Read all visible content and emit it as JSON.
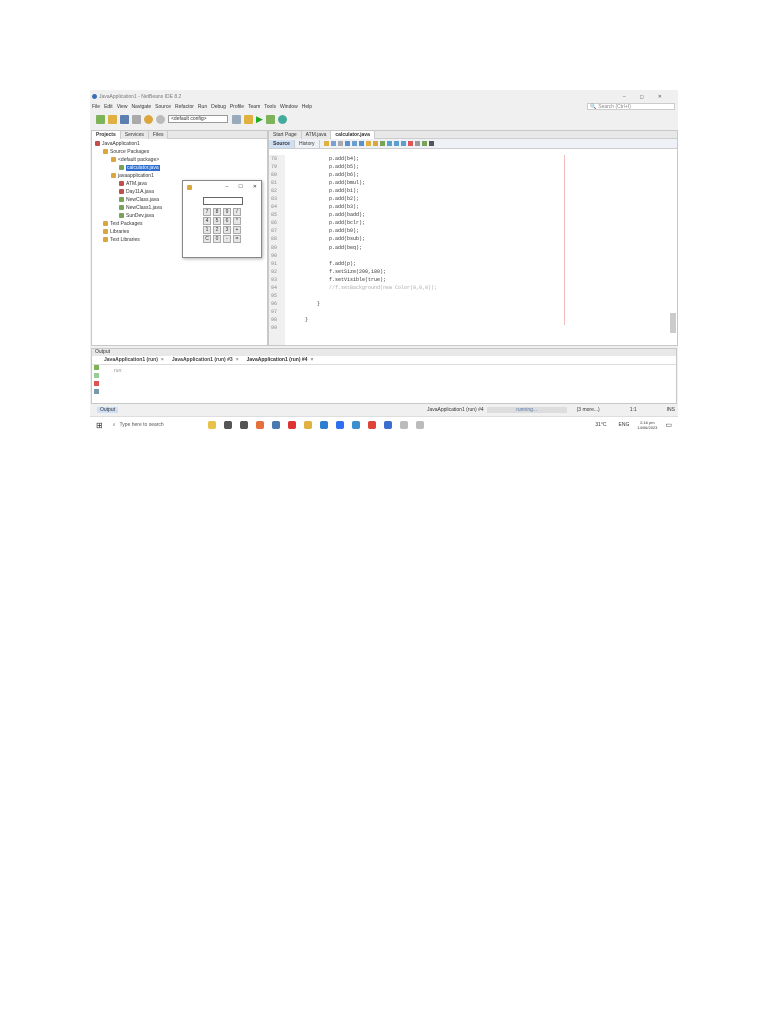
{
  "window": {
    "title": "JavaApplication1 - NetBeans IDE 8.2",
    "search_placeholder": "Search (Ctrl+I)"
  },
  "menu": [
    "File",
    "Edit",
    "View",
    "Navigate",
    "Source",
    "Refactor",
    "Run",
    "Debug",
    "Profile",
    "Team",
    "Tools",
    "Window",
    "Help"
  ],
  "toolbar": {
    "config": "<default config>"
  },
  "left_tabs": [
    "Projects",
    "Services",
    "Files"
  ],
  "tree": [
    {
      "label": "JavaApplication1",
      "level": 0,
      "color": "#c0504d"
    },
    {
      "label": "Source Packages",
      "level": 1,
      "color": "#d9a640"
    },
    {
      "label": "<default package>",
      "level": 2,
      "color": "#d9a640"
    },
    {
      "label": "calculator.java",
      "level": 3,
      "color": "#7aa35a",
      "selected": true
    },
    {
      "label": "javaapplication1",
      "level": 2,
      "color": "#d9a640"
    },
    {
      "label": "ATM.java",
      "level": 3,
      "color": "#c0504d"
    },
    {
      "label": "Day11A.java",
      "level": 3,
      "color": "#c0504d"
    },
    {
      "label": "NewClass.java",
      "level": 3,
      "color": "#7aa35a"
    },
    {
      "label": "NewClass1.java",
      "level": 3,
      "color": "#7aa35a"
    },
    {
      "label": "SunDev.java",
      "level": 3,
      "color": "#7aa35a"
    },
    {
      "label": "Test Packages",
      "level": 1,
      "color": "#d9a640"
    },
    {
      "label": "Libraries",
      "level": 1,
      "color": "#d9a640"
    },
    {
      "label": "Test Libraries",
      "level": 1,
      "color": "#d9a640"
    }
  ],
  "calculator": {
    "keys": [
      "7",
      "8",
      "9",
      "/",
      "4",
      "5",
      "6",
      "*",
      "1",
      "2",
      "3",
      "+",
      "C",
      "0",
      "-",
      "="
    ],
    "minimize": "–",
    "maximize": "☐",
    "close": "✕"
  },
  "editor_tabs": [
    "Start Page",
    "ATM.java",
    "calculator.java"
  ],
  "editor_subtabs": [
    "Source",
    "History"
  ],
  "code": [
    {
      "n": "78",
      "t": "        p.add(b4);"
    },
    {
      "n": "79",
      "t": "        p.add(b5);"
    },
    {
      "n": "80",
      "t": "        p.add(b6);"
    },
    {
      "n": "81",
      "t": "        p.add(bmul);"
    },
    {
      "n": "82",
      "t": "        p.add(b1);"
    },
    {
      "n": "83",
      "t": "        p.add(b2);"
    },
    {
      "n": "84",
      "t": "        p.add(b3);"
    },
    {
      "n": "85",
      "t": "        p.add(badd);"
    },
    {
      "n": "86",
      "t": "        p.add(bclr);"
    },
    {
      "n": "87",
      "t": "        p.add(b0);"
    },
    {
      "n": "88",
      "t": "        p.add(bsub);"
    },
    {
      "n": "89",
      "t": "        p.add(beq);"
    },
    {
      "n": "90",
      "t": ""
    },
    {
      "n": "91",
      "t": "        f.add(p);"
    },
    {
      "n": "92",
      "t": "        f.setSize(200,180);"
    },
    {
      "n": "93",
      "t": "        f.setVisible(true);"
    },
    {
      "n": "94",
      "t": "        //f.setBackground(new Color(0,0,0));",
      "comment": true
    },
    {
      "n": "95",
      "t": ""
    },
    {
      "n": "96",
      "t": "    }"
    },
    {
      "n": "97",
      "t": ""
    },
    {
      "n": "98",
      "t": "}"
    },
    {
      "n": "99",
      "t": ""
    }
  ],
  "output": {
    "title": "Output",
    "tabs": [
      "JavaApplication1 (run)",
      "JavaApplication1 (run) #3",
      "JavaApplication1 (run) #4"
    ],
    "text": "run:"
  },
  "status": {
    "output_label": "Output",
    "task": "JavaApplication1 (run) #4",
    "progress_text": "running...",
    "more": "(3 more...)",
    "position": "1:1",
    "mode": "INS"
  },
  "taskbar": {
    "search": "Type here to search",
    "weather": "31°C",
    "lang": "ENG",
    "time": "2:16 pm",
    "date": "14/06/2023"
  }
}
